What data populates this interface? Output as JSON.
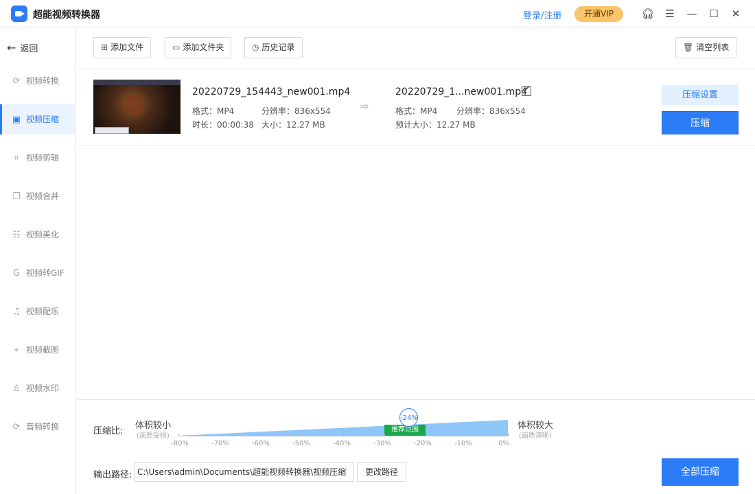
{
  "app": {
    "title": "超能视频转换器",
    "login": "登录/注册",
    "vip": "开通VIP"
  },
  "window_icons": [
    "headset-icon",
    "menu-icon",
    "minimize-icon",
    "maximize-icon",
    "close-icon"
  ],
  "sidebar": {
    "back": "返回",
    "items": [
      {
        "label": "视频转换",
        "icon": "convert-icon",
        "active": false
      },
      {
        "label": "视频压缩",
        "icon": "compress-icon",
        "active": true
      },
      {
        "label": "视频剪辑",
        "icon": "crop-icon",
        "active": false
      },
      {
        "label": "视频合并",
        "icon": "merge-icon",
        "active": false
      },
      {
        "label": "视频美化",
        "icon": "adjust-icon",
        "active": false
      },
      {
        "label": "视频转GIF",
        "icon": "gif-icon",
        "active": false
      },
      {
        "label": "视频配乐",
        "icon": "music-icon",
        "active": false
      },
      {
        "label": "视频截图",
        "icon": "screenshot-icon",
        "active": false
      },
      {
        "label": "视频水印",
        "icon": "watermark-icon",
        "active": false
      },
      {
        "label": "音频转换",
        "icon": "audio-convert-icon",
        "active": false
      }
    ]
  },
  "toolbar": {
    "add_file": "添加文件",
    "add_folder": "添加文件夹",
    "history": "历史记录",
    "clear_list": "清空列表"
  },
  "file": {
    "source_name": "20220729_154443_new001.mp4",
    "source_format": "格式：MP4",
    "source_resolution": "分辨率：836x554",
    "source_duration": "时长：00:00:38",
    "source_size": "大小：12.27 MB",
    "target_name": "20220729_1...new001.mp4",
    "target_format": "格式：MP4",
    "target_resolution": "分辨率：836x554",
    "target_size": "预计大小：12.27 MB",
    "settings_button": "压缩设置",
    "compress_button": "压缩"
  },
  "compression": {
    "label": "压缩比:",
    "left_title": "体积较小",
    "left_sub": "(画质受损)",
    "right_title": "体积较大",
    "right_sub": "(画质清晰)",
    "recommended": "推荐范围",
    "current": "-24%",
    "ticks": [
      "-80%",
      "-70%",
      "-60%",
      "-50%",
      "-40%",
      "-30%",
      "-20%",
      "-10%",
      "0%"
    ]
  },
  "output": {
    "label": "输出路径:",
    "path": "C:\\Users\\admin\\Documents\\超能视频转换器\\视频压缩",
    "change_button": "更改路径",
    "compress_all_button": "全部压缩"
  },
  "colors": {
    "accent": "#2b7cf6",
    "vip": "#f9c46a",
    "recommended": "#18a84a",
    "ramp": "#8fc6f8"
  }
}
